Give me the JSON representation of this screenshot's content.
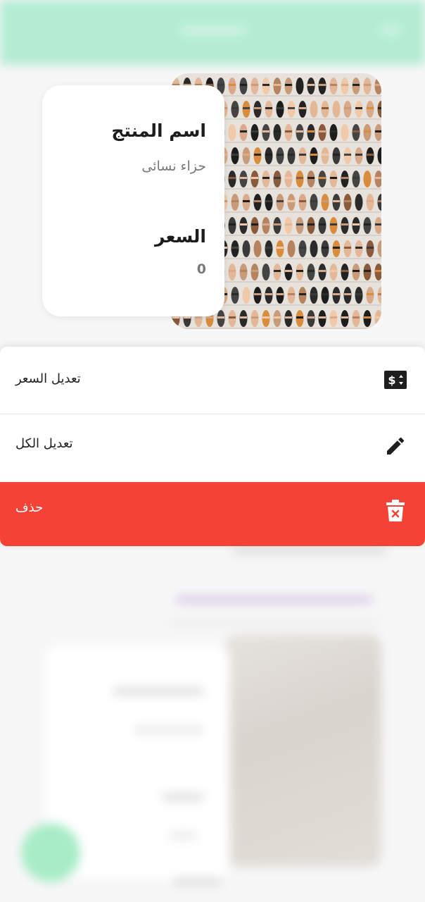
{
  "product": {
    "name_label": "اسم المنتج",
    "name_value": "حزاء نسائى",
    "price_label": "السعر",
    "price_value": "0"
  },
  "actions": [
    {
      "label": "تعديل السعر",
      "icon": "price-tag-icon"
    },
    {
      "label": "تعديل الكل",
      "icon": "pencil-icon"
    },
    {
      "label": "حذف",
      "icon": "trash-icon"
    }
  ],
  "colors": {
    "header": "#b3ecd3",
    "delete": "#f44336",
    "fab": "#a8ecc7"
  }
}
